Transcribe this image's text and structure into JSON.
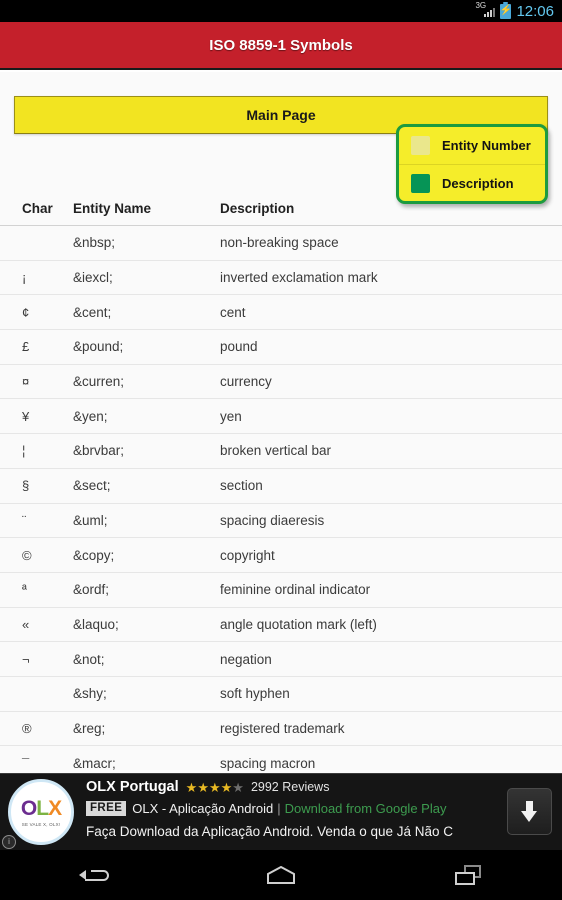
{
  "statusbar": {
    "network_label": "3G",
    "time": "12:06",
    "signal_icon": "signal-3g-icon",
    "battery_icon": "battery-charging-icon",
    "clock_color": "#63c8ef"
  },
  "titlebar": {
    "title": "ISO 8859-1 Symbols",
    "background": "#c4202b",
    "text_color": "#ffffff"
  },
  "main_button": {
    "label": "Main Page",
    "background": "#f2e421",
    "border_color": "#9b8f18"
  },
  "legend_popup": {
    "border_color": "#1d9b3f",
    "background": "#f5ed2a",
    "items": [
      {
        "label": "Entity Number",
        "checked": false,
        "swatch_color": "#eae78c"
      },
      {
        "label": "Description",
        "checked": true,
        "swatch_color": "#069456"
      }
    ]
  },
  "table": {
    "columns": [
      "Char",
      "Entity Name",
      "Description"
    ],
    "rows": [
      {
        "char": "",
        "name": "&nbsp;",
        "desc": "non-breaking space"
      },
      {
        "char": "¡",
        "name": "&iexcl;",
        "desc": "inverted exclamation mark"
      },
      {
        "char": "¢",
        "name": "&cent;",
        "desc": "cent"
      },
      {
        "char": "£",
        "name": "&pound;",
        "desc": "pound"
      },
      {
        "char": "¤",
        "name": "&curren;",
        "desc": "currency"
      },
      {
        "char": "¥",
        "name": "&yen;",
        "desc": "yen"
      },
      {
        "char": "¦",
        "name": "&brvbar;",
        "desc": "broken vertical bar"
      },
      {
        "char": "§",
        "name": "&sect;",
        "desc": "section"
      },
      {
        "char": "¨",
        "name": "&uml;",
        "desc": "spacing diaeresis"
      },
      {
        "char": "©",
        "name": "&copy;",
        "desc": "copyright"
      },
      {
        "char": "ª",
        "name": "&ordf;",
        "desc": "feminine ordinal indicator"
      },
      {
        "char": "«",
        "name": "&laquo;",
        "desc": "angle quotation mark (left)"
      },
      {
        "char": "¬",
        "name": "&not;",
        "desc": "negation"
      },
      {
        "char": "",
        "name": "&shy;",
        "desc": "soft hyphen"
      },
      {
        "char": "®",
        "name": "&reg;",
        "desc": "registered trademark"
      },
      {
        "char": "¯",
        "name": "&macr;",
        "desc": "spacing macron"
      }
    ]
  },
  "ad": {
    "logo": {
      "o": "O",
      "l": "L",
      "x": "X",
      "tagline": "SE VALE X, OLX!"
    },
    "info_icon_label": "i",
    "app_name": "OLX Portugal",
    "rating_stars_filled": 4,
    "rating_stars_total": 5,
    "reviews": "2992 Reviews",
    "price_badge": "FREE",
    "subtitle": "OLX - Aplicação Android",
    "separator": "|",
    "store_link": "Download from Google Play",
    "description": "Faça Download da Aplicação Android. Venda o que Já Não C",
    "download_icon": "download-arrow-icon",
    "link_color": "#3d9c4f"
  },
  "navbar": {
    "back_icon": "back-arrow-icon",
    "home_icon": "home-icon",
    "recent_icon": "recent-apps-icon"
  }
}
